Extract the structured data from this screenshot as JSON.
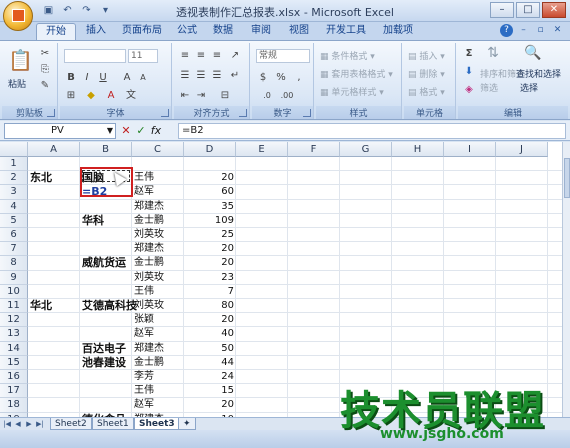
{
  "window": {
    "title": "透视表制作汇总报表.xlsx - Microsoft Excel"
  },
  "tabs": [
    "开始",
    "插入",
    "页面布局",
    "公式",
    "数据",
    "审阅",
    "视图",
    "开发工具",
    "加载项"
  ],
  "ribbon": {
    "clipboard": {
      "label": "剪贴板",
      "paste": "粘贴"
    },
    "font": {
      "label": "字体",
      "size": "11",
      "bold": "B",
      "italic": "I",
      "underline": "U"
    },
    "alignment": {
      "label": "对齐方式"
    },
    "number": {
      "label": "数字",
      "format": "常规",
      "percent": "%",
      "comma": ",",
      "currency": "$"
    },
    "styles": {
      "label": "样式",
      "cond": "条件格式",
      "table": "套用表格格式",
      "cell": "单元格样式"
    },
    "cells": {
      "label": "单元格",
      "insert": "插入",
      "delete": "删除",
      "format": "格式"
    },
    "editing": {
      "label": "编辑",
      "sort": "排序和筛选",
      "find": "查找和选择",
      "sort_short": "筛选",
      "find_short": "选择"
    }
  },
  "formula_bar": {
    "name_box": "PV",
    "formula": "=B2"
  },
  "grid": {
    "columns": [
      "A",
      "B",
      "C",
      "D",
      "E",
      "F",
      "G",
      "H",
      "I",
      "J"
    ],
    "rows": [
      "1",
      "2",
      "3",
      "4",
      "5",
      "6",
      "7",
      "8",
      "9",
      "10",
      "11",
      "12",
      "13",
      "14",
      "15",
      "16",
      "17",
      "18",
      "19"
    ],
    "cells": {
      "A2": "东北",
      "A11": "华北",
      "B2": "国脑",
      "B3": "=B2",
      "B5": "华科",
      "B8": "威航货运",
      "B11": "艾德高科技",
      "B14": "百达电子",
      "B15": "池春建设",
      "B19": "德化食品",
      "C2": "王伟",
      "C3": "赵军",
      "C4": "郑建杰",
      "C5": "金士鹏",
      "C6": "刘英玫",
      "C7": "郑建杰",
      "C8": "金士鹏",
      "C9": "刘英玫",
      "C10": "王伟",
      "C11": "刘英玫",
      "C12": "张颖",
      "C13": "赵军",
      "C14": "郑建杰",
      "C15": "金士鹏",
      "C16": "李芳",
      "C17": "王伟",
      "C18": "赵军",
      "C19": "郑建杰",
      "D2": "20",
      "D3": "60",
      "D4": "35",
      "D5": "109",
      "D6": "25",
      "D7": "20",
      "D8": "20",
      "D9": "23",
      "D10": "7",
      "D11": "80",
      "D12": "20",
      "D13": "40",
      "D14": "50",
      "D15": "44",
      "D16": "24",
      "D17": "15",
      "D18": "20",
      "D19": "10"
    }
  },
  "sheets": [
    "Sheet2",
    "Sheet1",
    "Sheet3"
  ],
  "active_sheet": "Sheet3",
  "watermark": {
    "text": "技术员联盟",
    "url": "www.jsgho.com"
  }
}
